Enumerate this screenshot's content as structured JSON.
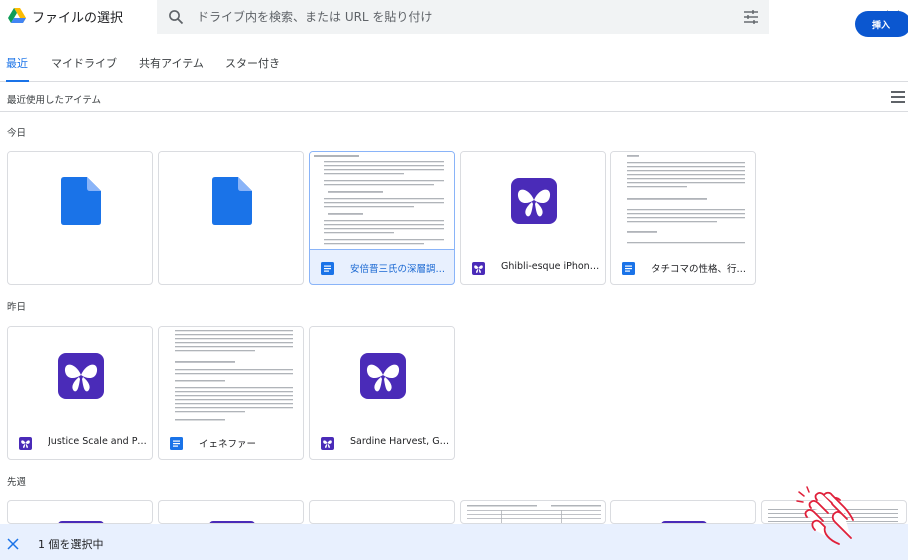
{
  "app": {
    "title": "ファイルの選択",
    "logo_icon": "google-drive-logo-icon"
  },
  "search": {
    "placeholder": "ドライブ内を検索、または URL を貼り付け",
    "value": ""
  },
  "tabs": [
    {
      "label": "最近",
      "active": true
    },
    {
      "label": "マイドライブ",
      "active": false
    },
    {
      "label": "共有アイテム",
      "active": false
    },
    {
      "label": "スター付き",
      "active": false
    }
  ],
  "section": {
    "title": "最近使用したアイテム",
    "view_icon": "list-view-icon"
  },
  "groups": {
    "today": "今日",
    "yesterday": "昨日",
    "last_week": "先週"
  },
  "today_items": [
    {
      "label": "",
      "type": "doc-file-icon"
    },
    {
      "label": "",
      "type": "doc-file-icon"
    },
    {
      "label": "安倍晋三氏の深層調…",
      "type": "doc-file-icon",
      "selected": true
    },
    {
      "label": "Ghibli-esque iPhone …",
      "type": "app-logo-icon"
    },
    {
      "label": "タチコマの性格、行…",
      "type": "doc-file-icon"
    }
  ],
  "yesterday_items": [
    {
      "label": "Justice Scale and Pr…",
      "type": "app-logo-icon"
    },
    {
      "label": "イェネファー",
      "type": "doc-file-icon"
    },
    {
      "label": "Sardine Harvest, Ghi…",
      "type": "app-logo-icon"
    }
  ],
  "footer": {
    "selected_count": "1 個を選択中",
    "insert_label": "挿入"
  },
  "colors": {
    "accent": "#1a73e8",
    "doc_blue": "#1a73e8",
    "app_purple": "#4a2bb8",
    "selected_bg": "#e8f0fe",
    "insert_bg": "#0b57d0"
  }
}
